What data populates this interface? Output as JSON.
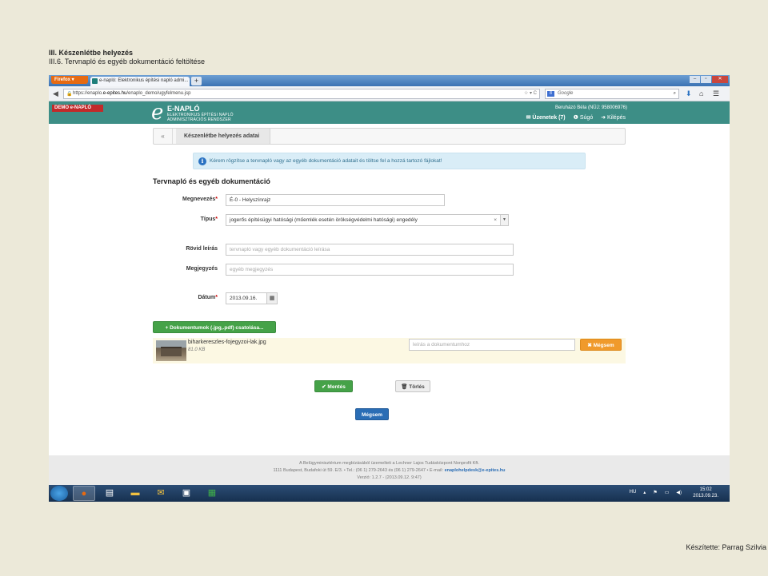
{
  "doc": {
    "heading": "III. Készenlétbe helyezés",
    "subheading": "III.6. Tervnapló és egyéb dokumentáció feltöltése",
    "credit": "Készítette: Parrag Szilvia"
  },
  "browser": {
    "firefox_label": "Firefox",
    "tab_title": "e-napló: Elektronikus építési napló admi...",
    "new_tab": "+",
    "url_scheme": "https://enaplo.",
    "url_domain": "e-epites.hu",
    "url_path": "/enaplo_demo/ugyfelmenu.jsp",
    "search_placeholder": "Google",
    "search_engine": "8"
  },
  "app": {
    "demo_badge": "DEMO e-NAPLÓ",
    "logo_letter": "e",
    "logo_title": "E-NAPLÓ",
    "logo_sub1": "ELEKTRONIKUS ÉPÍTÉSI NAPLÓ",
    "logo_sub2": "ADMINISZTRÁCIÓS RENDSZER",
    "user": "Beruházó Béla (NÜJ: 958006976)",
    "messages": "Üzenetek (7)",
    "help": "Súgó",
    "logout": "Kilépés"
  },
  "breadcrumb": {
    "back": "«",
    "current": "Készenlétbe helyezés adatai"
  },
  "alert": "Kérem rögzítse a tervnapló vagy az egyéb dokumentáció adatait és töltse fel a hozzá tartozó fájlokat!",
  "section_title": "Tervnapló és egyéb dokumentáció",
  "form": {
    "name_label": "Megnevezés",
    "name_value": "É-0 - Helyszínrajz",
    "type_label": "Típus",
    "type_value": "jogerős építésügyi hatósági (műemlék esetén örökségvédelmi hatósági) engedély",
    "short_desc_label": "Rövid leírás",
    "short_desc_placeholder": "tervnapló vagy egyéb dokumentáció leírása",
    "note_label": "Megjegyzés",
    "note_placeholder": "egyéb megjegyzés",
    "date_label": "Dátum",
    "date_value": "2013.09.16.",
    "required_mark": "*"
  },
  "attach_button": "+ Dokumentumok (.jpg,.pdf) csatolása...",
  "file": {
    "name": "biharkereszles-fojegyzoi-lak.jpg",
    "size": "81.0 KB",
    "desc_placeholder": "leírás a dokumentumhoz",
    "cancel": "✖ Mégsem"
  },
  "actions": {
    "save": "✔ Mentés",
    "delete": "🗑 Törlés",
    "cancel": "Mégsem"
  },
  "footer": {
    "line1": "A Belügyminisztérium megbízásából üzemelteti a Lechner Lajos Tudásközpont Nonprofit Kft.",
    "line2": "1111 Budapest, Budafoki út 59. E/3. • Tel.: (06 1) 279-2643 és (06 1) 279-2647 • E-mail: ",
    "email": "enaplohelpdesk@e-epites.hu",
    "version": "Verzió: 1.2.7 - (2013.09.12. 9:47)"
  },
  "taskbar": {
    "lang": "HU",
    "time": "15:02",
    "date": "2013.09.23."
  }
}
